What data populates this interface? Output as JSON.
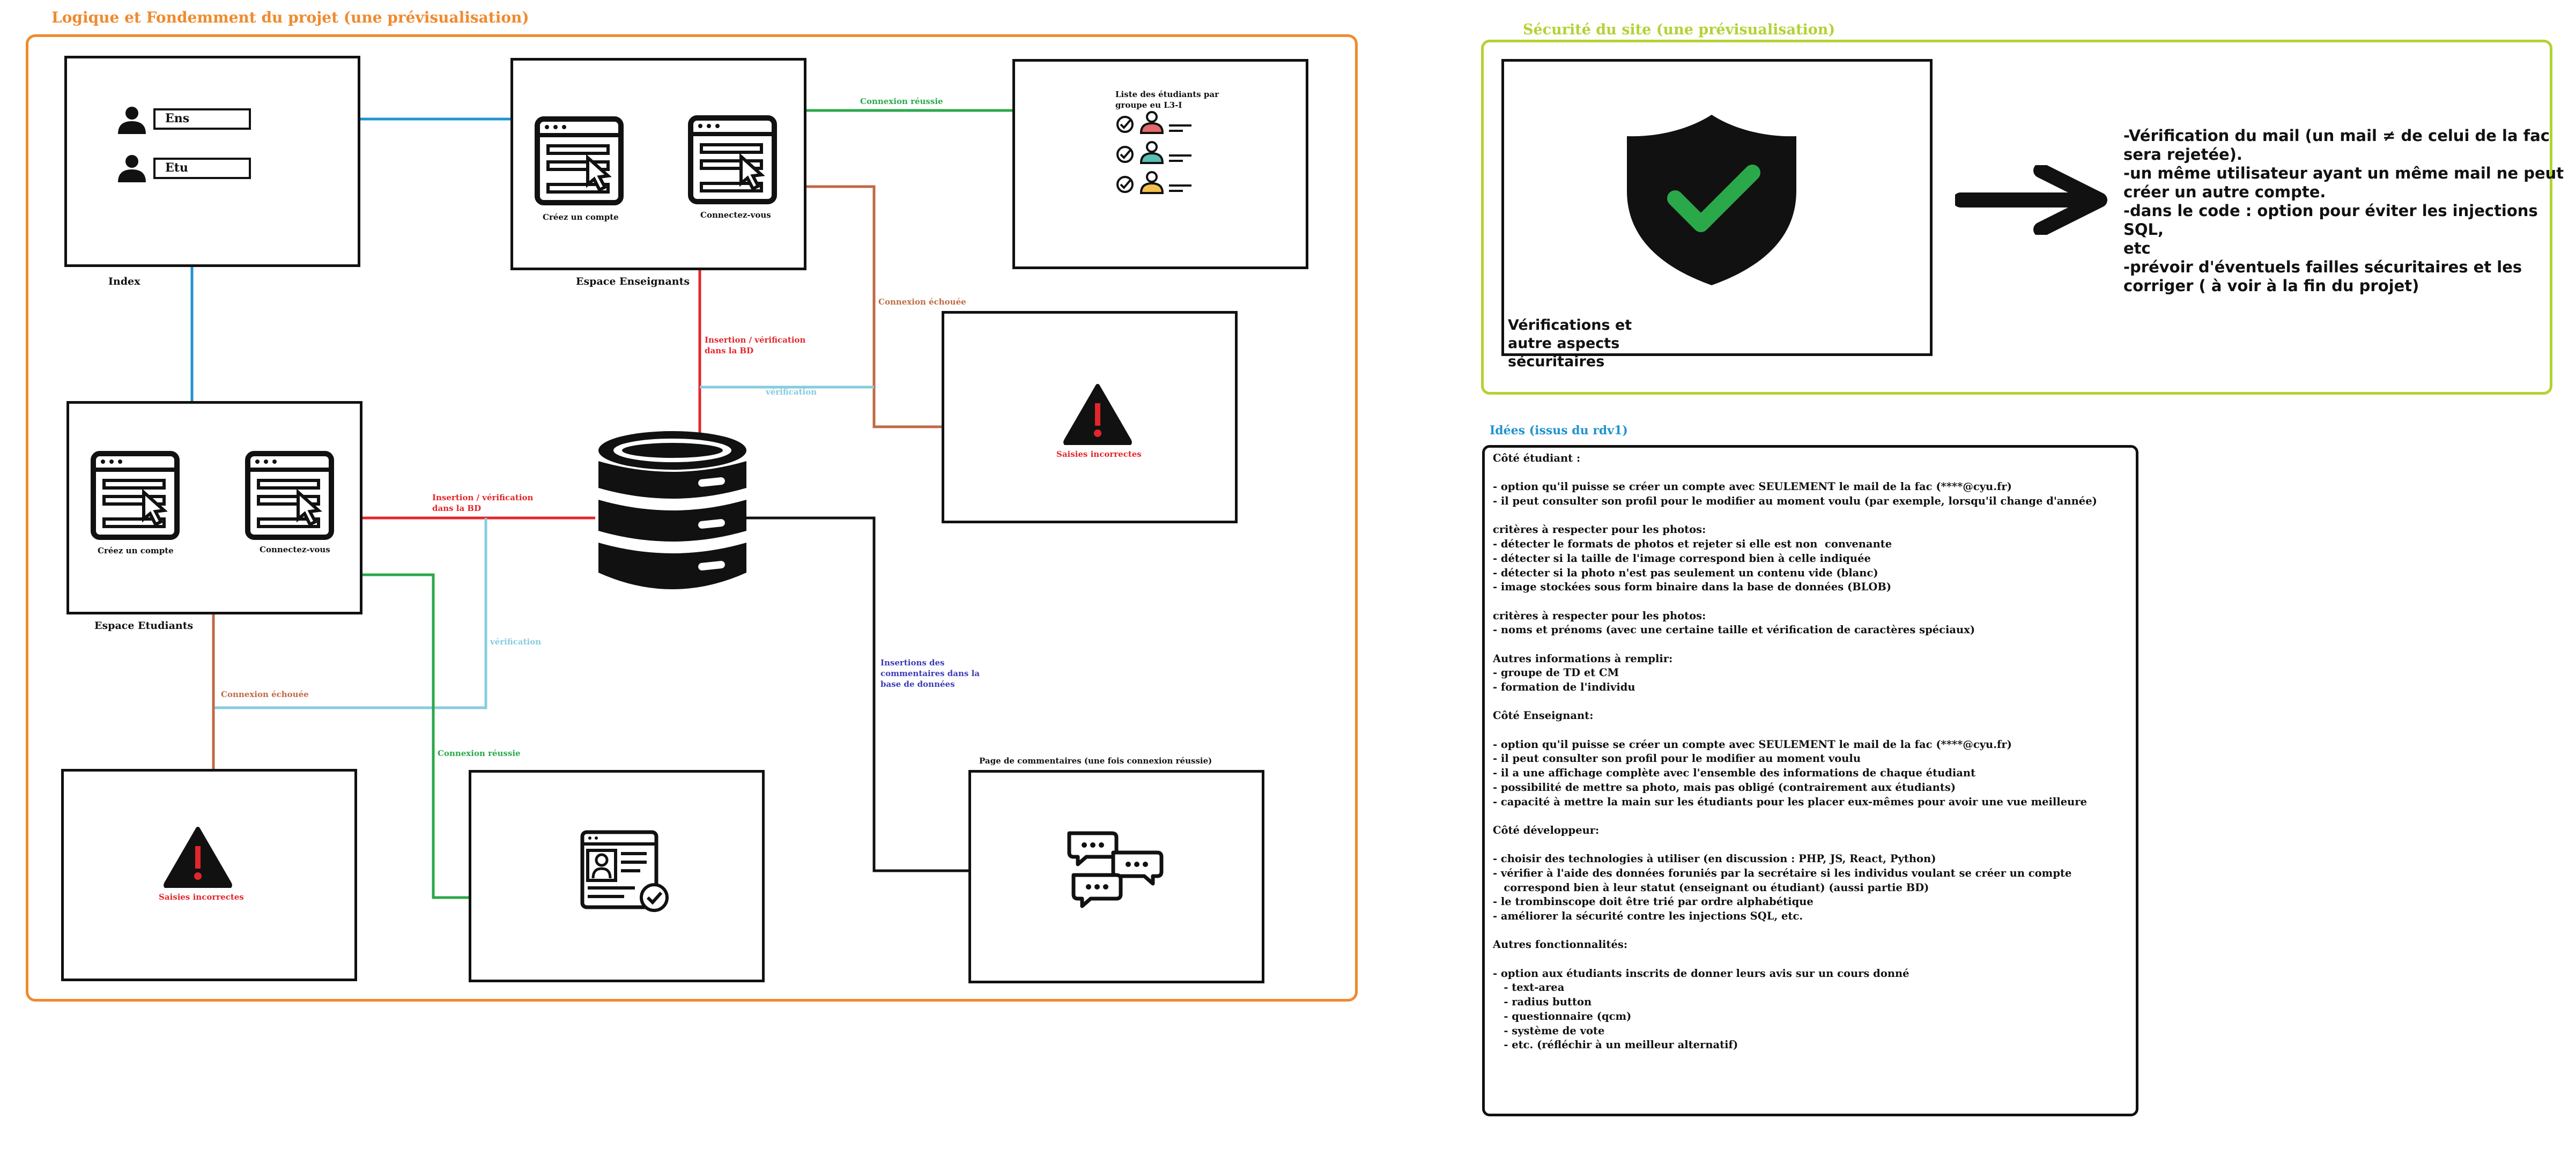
{
  "colors": {
    "orange": "#F08A2E",
    "lime": "#B3D234",
    "blue": "#1F93CF",
    "light_blue": "#86CCE0",
    "green": "#2BA84A",
    "red": "#E3262B",
    "brown": "#C06A45",
    "black": "#111111",
    "purple": "#3B3BB5"
  },
  "main": {
    "title": "Logique et Fondemment du projet (une prévisualisation)",
    "index": {
      "label": "Index",
      "ens": "Ens",
      "etu": "Etu"
    },
    "teachers": {
      "label": "Espace Enseignants",
      "create": "Créez un compte",
      "login": "Connectez-vous"
    },
    "students": {
      "label": "Espace Etudiants",
      "create": "Créez un compte",
      "login": "Connectez-vous"
    },
    "student_list": {
      "title": "Liste des étudiants par groupe eu L3-I"
    },
    "error_teacher": "Saisies incorrectes",
    "error_student": "Saisies incorrectes",
    "comments_title": "Page de commentaires (une fois connexion réussie)",
    "connectors": {
      "connexion_reussie_top": "Connexion réussie",
      "connexion_echouee_top": "Connexion échouée",
      "insertion_bd_top": "Insertion / vérification dans la BD",
      "verification_top": "vérification",
      "insertion_bd_left": "Insertion / vérification dans la BD",
      "verification_left": "vérification",
      "connexion_echouee_bottom": "Connexion échouée",
      "connexion_reussie_bottom": "Connexion réussie",
      "insertions_commentaires": "Insertions des commentaires dans la base de données"
    }
  },
  "security": {
    "title": "Sécurité du site (une prévisualisation)",
    "shield_caption": "Vérifications et autre aspects sécuritaires",
    "lines": [
      "-Vérification du mail (un mail ≠ de celui de la fac",
      "sera rejetée).",
      "-un même utilisateur ayant un même mail ne peut",
      "créer un autre compte.",
      "-dans le code : option pour éviter les injections SQL,",
      "etc",
      "-prévoir d'éventuels failles sécuritaires et les",
      "corriger ( à voir à la fin du projet)"
    ]
  },
  "ideas": {
    "title": "Idées (issus du rdv1)",
    "lines": [
      {
        "t": "Côté étudiant :",
        "b": true
      },
      {
        "t": "",
        "b": false
      },
      {
        "t": "- option qu'il puisse se créer un compte avec SEULEMENT le mail de la fac (****@cyu.fr)",
        "b": true
      },
      {
        "t": "- il peut consulter son profil pour le modifier au moment voulu (par exemple, lorsqu'il change d'année)",
        "b": true
      },
      {
        "t": "",
        "b": false
      },
      {
        "t": "critères à respecter pour les photos:",
        "b": true
      },
      {
        "t": "- détecter le formats de photos et rejeter si elle est non  convenante",
        "b": true
      },
      {
        "t": "- détecter si la taille de l'image correspond bien à celle indiquée",
        "b": true
      },
      {
        "t": "- détecter si la photo n'est pas seulement un contenu vide (blanc)",
        "b": true
      },
      {
        "t": "- image stockées sous form binaire dans la base de données (BLOB)",
        "b": true
      },
      {
        "t": "",
        "b": false
      },
      {
        "t": "critères à respecter pour les photos:",
        "b": true
      },
      {
        "t": "- noms et prénoms (avec une certaine taille et vérification de caractères spéciaux)",
        "b": true
      },
      {
        "t": "",
        "b": false
      },
      {
        "t": "Autres informations à remplir:",
        "b": true
      },
      {
        "t": "- groupe de TD et CM",
        "b": true
      },
      {
        "t": "- formation de l'individu",
        "b": true
      },
      {
        "t": "",
        "b": false
      },
      {
        "t": "Côté Enseignant:",
        "b": true
      },
      {
        "t": "",
        "b": false
      },
      {
        "t": "- option qu'il puisse se créer un compte avec SEULEMENT le mail de la fac (****@cyu.fr)",
        "b": true
      },
      {
        "t": "- il peut consulter son profil pour le modifier au moment voulu",
        "b": true
      },
      {
        "t": "- il a une affichage complète avec l'ensemble des informations de chaque étudiant",
        "b": true
      },
      {
        "t": "- possibilité de mettre sa photo, mais pas obligé (contrairement aux étudiants)",
        "b": true
      },
      {
        "t": "- capacité à mettre la main sur les étudiants pour les placer eux-mêmes pour avoir une vue meilleure",
        "b": true
      },
      {
        "t": "",
        "b": false
      },
      {
        "t": "Côté développeur:",
        "b": true
      },
      {
        "t": "",
        "b": false
      },
      {
        "t": "- choisir des technologies à utiliser (en discussion : PHP, JS, React, Python)",
        "b": true
      },
      {
        "t": "- vérifier à l'aide des données foruniés par la secrétaire si les individus voulant se créer un compte",
        "b": true
      },
      {
        "t": "   correspond bien à leur statut (enseignant ou étudiant) (aussi partie BD)",
        "b": true
      },
      {
        "t": "- le trombinscope doit être trié par ordre alphabétique",
        "b": true
      },
      {
        "t": "- améliorer la sécurité contre les injections SQL, etc.",
        "b": true
      },
      {
        "t": "",
        "b": false
      },
      {
        "t": "Autres fonctionnalités:",
        "b": true
      },
      {
        "t": "",
        "b": false
      },
      {
        "t": "- option aux étudiants inscrits de donner leurs avis sur un cours donné",
        "b": true
      },
      {
        "t": "   - text-area",
        "b": true
      },
      {
        "t": "   - radius button",
        "b": true
      },
      {
        "t": "   - questionnaire (qcm)",
        "b": true
      },
      {
        "t": "   - système de vote",
        "b": true
      },
      {
        "t": "   - etc. (réfléchir à un meilleur alternatif)",
        "b": true
      }
    ]
  }
}
